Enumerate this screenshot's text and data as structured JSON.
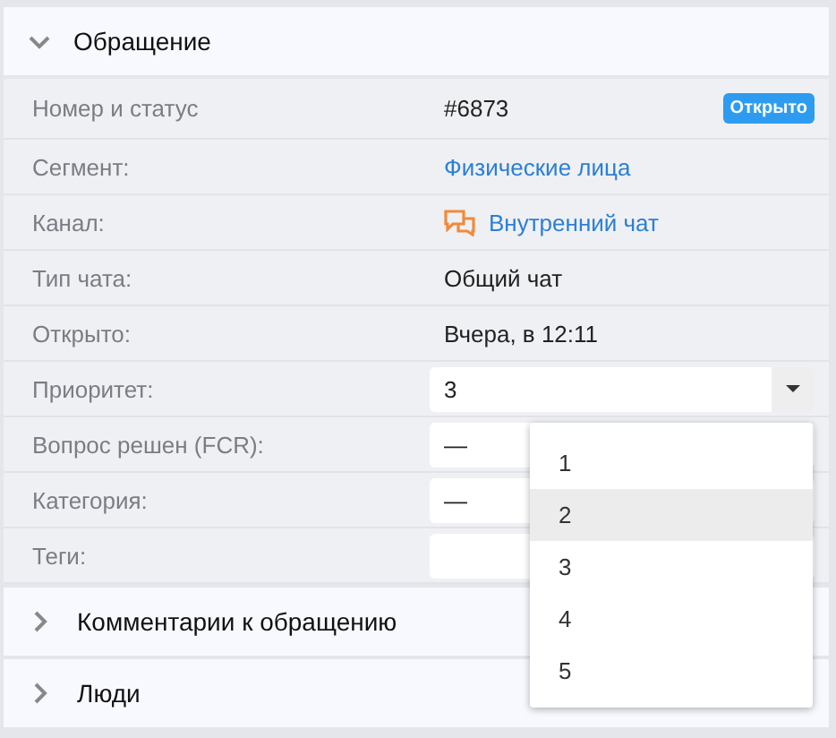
{
  "sections": [
    {
      "title": "Обращение",
      "expanded": true,
      "rows": [
        {
          "kind": "status",
          "label": "Номер и статус",
          "value": "#6873",
          "badge": "Открыто"
        },
        {
          "kind": "link",
          "label": "Сегмент:",
          "value": "Физические лица"
        },
        {
          "kind": "channel",
          "label": "Канал:",
          "value": "Внутренний чат"
        },
        {
          "kind": "text",
          "label": "Тип чата:",
          "value": "Общий чат"
        },
        {
          "kind": "text",
          "label": "Открыто:",
          "value": "Вчера, в 12:11"
        },
        {
          "kind": "select",
          "label": "Приоритет:",
          "value": "3",
          "expanded": true,
          "options": [
            {
              "label": "1",
              "highlighted": false
            },
            {
              "label": "2",
              "highlighted": true
            },
            {
              "label": "3",
              "highlighted": false
            },
            {
              "label": "4",
              "highlighted": false
            },
            {
              "label": "5",
              "highlighted": false
            }
          ]
        },
        {
          "kind": "field",
          "label": "Вопрос решен (FCR):",
          "value": "—"
        },
        {
          "kind": "field",
          "label": "Категория:",
          "value": "—"
        },
        {
          "kind": "field",
          "label": "Теги:"
        }
      ]
    },
    {
      "title": "Комментарии к обращению",
      "expanded": false
    },
    {
      "title": "Люди",
      "expanded": false
    }
  ]
}
